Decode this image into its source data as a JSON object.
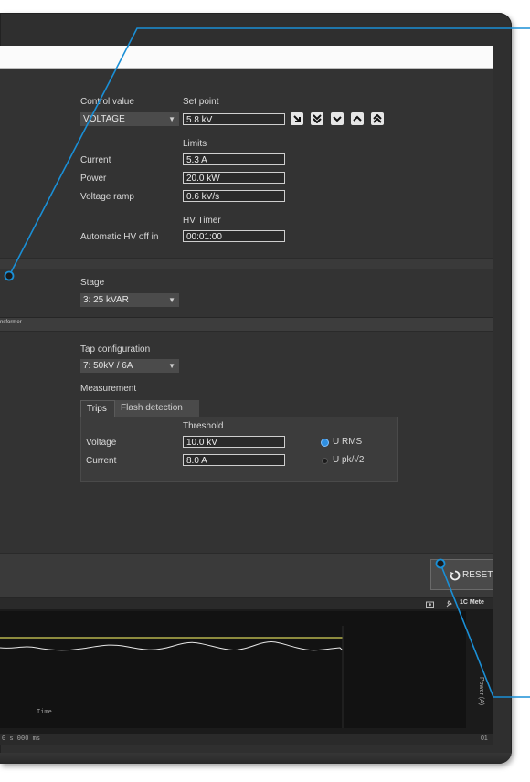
{
  "control": {
    "control_value_label": "Control value",
    "control_value": "VOLTAGE",
    "set_point_label": "Set point",
    "set_point_value": "5.8 kV"
  },
  "limits": {
    "header": "Limits",
    "current_label": "Current",
    "current_value": "5.3 A",
    "power_label": "Power",
    "power_value": "20.0 kW",
    "ramp_label": "Voltage ramp",
    "ramp_value": "0.6 kV/s"
  },
  "hv_timer": {
    "header": "HV Timer",
    "auto_off_label": "Automatic HV off in",
    "auto_off_value": "00:01:00"
  },
  "stage": {
    "label": "Stage",
    "value": "3: 25 kVAR"
  },
  "section": {
    "transformer_label": "nsformer"
  },
  "tap": {
    "label": "Tap configuration",
    "value": "7: 50kV / 6A"
  },
  "measurement": {
    "label": "Measurement",
    "tabs": [
      "Trips",
      "Flash detection"
    ],
    "threshold_header": "Threshold",
    "voltage_label": "Voltage",
    "voltage_value": "10.0 kV",
    "current_label": "Current",
    "current_value": "8.0 A",
    "radio_rms": "U RMS",
    "radio_pk": "U pk/√2"
  },
  "reset_label": "RESET",
  "chart_header": "1C Mete",
  "chart_time_label": "Time",
  "chart_axis_left": "0 s 000 ms",
  "chart_axis_right": "01",
  "chart_vertical_label": "Power (A)",
  "colors": {
    "accent_blue": "#1a8fd6",
    "field_border": "#cfcfcf",
    "trace_yellow": "#d7d45a"
  }
}
